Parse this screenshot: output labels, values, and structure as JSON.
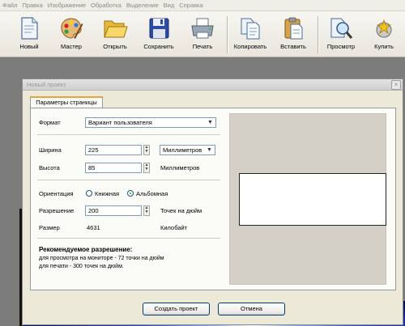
{
  "menu": [
    "Файл",
    "Правка",
    "Изображение",
    "Обработка",
    "Выделение",
    "Вид",
    "Справка"
  ],
  "toolbar": {
    "new": "Новый",
    "wizard": "Мастер",
    "open": "Открыть",
    "save": "Сохранить",
    "print": "Печать",
    "copy": "Копировать",
    "paste": "Вставить",
    "preview": "Просмотр",
    "buy": "Купить"
  },
  "dialog": {
    "title": "Новый проект",
    "close": "×",
    "tab": "Параметры страницы",
    "format_label": "Формат",
    "format_value": "Вариант пользователя",
    "width_label": "Ширина",
    "width_value": "225",
    "units_value": "Миллиметров",
    "height_label": "Высота",
    "height_value": "85",
    "height_units": "Миллиметров",
    "orientation_label": "Ориентация",
    "orientation_portrait": "Книжная",
    "orientation_landscape": "Альбомная",
    "orientation_selected": "landscape",
    "resolution_label": "Разрешение",
    "resolution_value": "200",
    "resolution_units": "Точек на дюйм",
    "size_label": "Размер",
    "size_value": "4631",
    "size_units": "Килобайт",
    "rec_title": "Рекомендуемое разрешение:",
    "rec_line1": "для просмотра на мониторе - 72 точки на дюйм",
    "rec_line2": "для печати - 300 точек на дюйм.",
    "create_button": "Создать проект",
    "cancel_button": "Отмена"
  },
  "icons": {
    "new": "new-document-icon",
    "wizard": "palette-icon",
    "open": "folder-icon",
    "save": "floppy-disk-icon",
    "print": "printer-icon",
    "copy": "copy-icon",
    "paste": "clipboard-icon",
    "preview": "magnifier-icon",
    "buy": "cart-icon"
  }
}
